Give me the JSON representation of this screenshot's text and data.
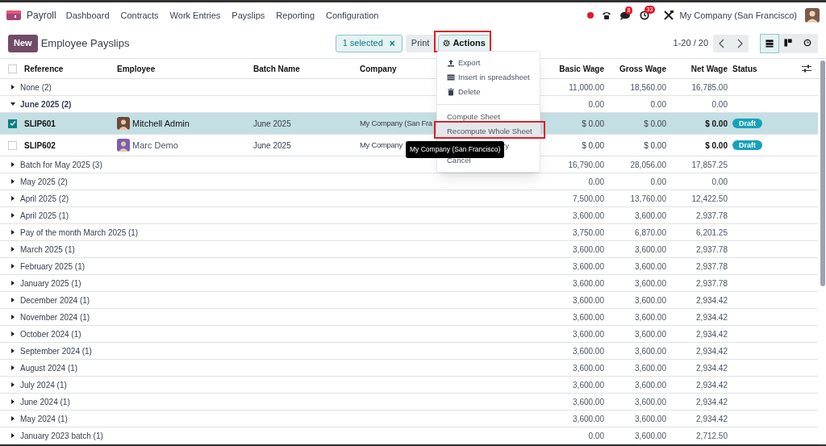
{
  "navbar": {
    "app": "Payroll",
    "menus": [
      "Dashboard",
      "Contracts",
      "Work Entries",
      "Payslips",
      "Reporting",
      "Configuration"
    ],
    "chat_badge": "8",
    "activity_badge": "33",
    "company": "My Company (San Francisco)"
  },
  "control_panel": {
    "new_button": "New",
    "title": "Employee Payslips",
    "selection": "1 selected",
    "selection_clear": "×",
    "print": "Print",
    "actions": {
      "label": "Actions",
      "annotated": true
    },
    "pager": "1-20 / 20",
    "views": [
      {
        "kind": "list",
        "selected": true
      },
      {
        "kind": "kanban",
        "selected": false
      },
      {
        "kind": "activity",
        "selected": false
      }
    ]
  },
  "table": {
    "select_all_checked": false,
    "columns": [
      "Reference",
      "Employee",
      "Batch Name",
      "Company",
      "Basic Wage",
      "Gross Wage",
      "Net Wage",
      "Status"
    ],
    "rows": [
      {
        "kind": "group",
        "label": "None (2)",
        "expanded": false,
        "basic": "11,000.00",
        "gross": "18,560.00",
        "net": "16,785.00"
      },
      {
        "kind": "group",
        "label": "June 2025 (2)",
        "expanded": true,
        "basic": "0.00",
        "gross": "0.00",
        "net": "0.00"
      },
      {
        "kind": "record",
        "selected": true,
        "reference": "SLIP601",
        "employee": "Mitchell Admin",
        "batch": "June 2025",
        "company": "My Company (San Fra",
        "basic": "$ 0.00",
        "gross": "$ 0.00",
        "net": "$ 0.00",
        "status": "Draft"
      },
      {
        "kind": "record",
        "selected": false,
        "reference": "SLIP602",
        "employee": "Marc Demo",
        "batch": "June 2025",
        "company": "My Company",
        "basic": "$ 0.00",
        "gross": "$ 0.00",
        "net": "$ 0.00",
        "status": "Draft"
      },
      {
        "kind": "group",
        "label": "Batch for May 2025 (3)",
        "expanded": false,
        "basic": "16,790.00",
        "gross": "28,056.00",
        "net": "17,857.25"
      },
      {
        "kind": "group",
        "label": "May 2025 (2)",
        "expanded": false,
        "basic": "0.00",
        "gross": "0.00",
        "net": "0.00"
      },
      {
        "kind": "group",
        "label": "April 2025 (2)",
        "expanded": false,
        "basic": "7,500.00",
        "gross": "13,760.00",
        "net": "12,422.50"
      },
      {
        "kind": "group",
        "label": "April 2025 (1)",
        "expanded": false,
        "basic": "3,600.00",
        "gross": "3,600.00",
        "net": "2,937.78"
      },
      {
        "kind": "group",
        "label": "Pay of the month March 2025 (1)",
        "expanded": false,
        "basic": "3,750.00",
        "gross": "6,870.00",
        "net": "6,201.25"
      },
      {
        "kind": "group",
        "label": "March 2025 (1)",
        "expanded": false,
        "basic": "3,600.00",
        "gross": "3,600.00",
        "net": "2,937.78"
      },
      {
        "kind": "group",
        "label": "February 2025 (1)",
        "expanded": false,
        "basic": "3,600.00",
        "gross": "3,600.00",
        "net": "2,937.78"
      },
      {
        "kind": "group",
        "label": "January 2025 (1)",
        "expanded": false,
        "basic": "3,600.00",
        "gross": "3,600.00",
        "net": "2,937.78"
      },
      {
        "kind": "group",
        "label": "December 2024 (1)",
        "expanded": false,
        "basic": "3,600.00",
        "gross": "3,600.00",
        "net": "2,934.42"
      },
      {
        "kind": "group",
        "label": "November 2024 (1)",
        "expanded": false,
        "basic": "3,600.00",
        "gross": "3,600.00",
        "net": "2,934.42"
      },
      {
        "kind": "group",
        "label": "October 2024 (1)",
        "expanded": false,
        "basic": "3,600.00",
        "gross": "3,600.00",
        "net": "2,934.42"
      },
      {
        "kind": "group",
        "label": "September 2024 (1)",
        "expanded": false,
        "basic": "3,600.00",
        "gross": "3,600.00",
        "net": "2,934.42"
      },
      {
        "kind": "group",
        "label": "August 2024 (1)",
        "expanded": false,
        "basic": "3,600.00",
        "gross": "3,600.00",
        "net": "2,934.42"
      },
      {
        "kind": "group",
        "label": "July 2024 (1)",
        "expanded": false,
        "basic": "3,600.00",
        "gross": "3,600.00",
        "net": "2,934.42"
      },
      {
        "kind": "group",
        "label": "June 2024 (1)",
        "expanded": false,
        "basic": "3,600.00",
        "gross": "3,600.00",
        "net": "2,934.42"
      },
      {
        "kind": "group",
        "label": "May 2024 (1)",
        "expanded": false,
        "basic": "3,600.00",
        "gross": "3,600.00",
        "net": "2,934.42"
      },
      {
        "kind": "group",
        "label": "January 2023 batch (1)",
        "expanded": false,
        "basic": "0.00",
        "gross": "3,600.00",
        "net": "2,712.50"
      }
    ]
  },
  "actions_menu": {
    "items": [
      {
        "kind": "export",
        "label": "Export",
        "selected": false
      },
      {
        "kind": "spreadsheet",
        "label": "Insert in spreadsheet",
        "selected": false
      },
      {
        "kind": "delete",
        "label": "Delete",
        "selected": false
      },
      {
        "kind": "divider"
      },
      {
        "kind": "plain",
        "label": "Compute Sheet",
        "selected": false
      },
      {
        "kind": "plain",
        "label": "Recompute Whole Sheet",
        "selected": true,
        "annotated": true
      },
      {
        "kind": "covered",
        "label": "ry",
        "selected": false
      },
      {
        "kind": "plain",
        "label": "Cancel",
        "selected": false
      }
    ]
  },
  "tooltip": "My Company (San Francisco)"
}
